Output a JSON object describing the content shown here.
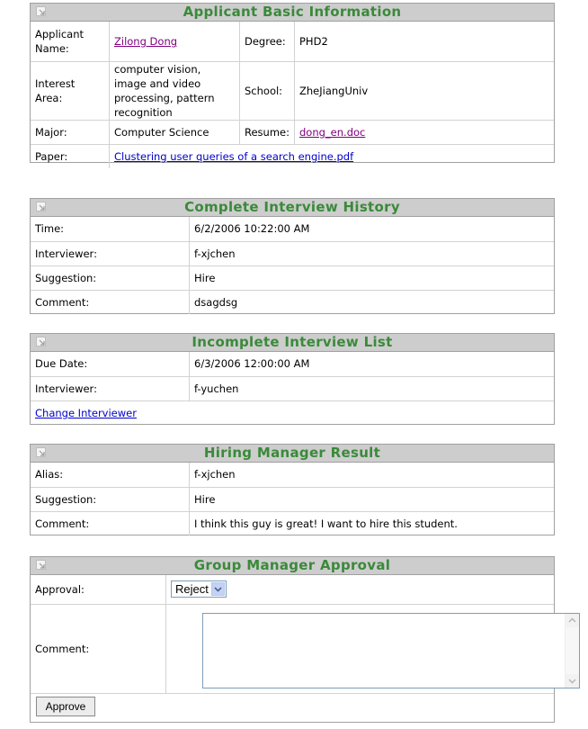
{
  "basic_info": {
    "title": "Applicant Basic Information",
    "applicant_name_label": "Applicant Name:",
    "applicant_name": "Zilong Dong",
    "degree_label": "Degree:",
    "degree": "PHD2",
    "interest_label": "Interest Area:",
    "interest": "computer vision, image and video processing, pattern recognition",
    "school_label": "School:",
    "school": "ZheJiangUniv",
    "major_label": "Major:",
    "major": "Computer Science",
    "resume_label": "Resume:",
    "resume": "dong_en.doc",
    "paper_label": "Paper:",
    "paper": "Clustering user queries of a search engine.pdf"
  },
  "complete_history": {
    "title": "Complete Interview History",
    "time_label": "Time:",
    "time": "6/2/2006 10:22:00 AM",
    "interviewer_label": "Interviewer:",
    "interviewer": "f-xjchen",
    "suggestion_label": "Suggestion:",
    "suggestion": "Hire",
    "comment_label": "Comment:",
    "comment": "dsagdsg"
  },
  "incomplete_list": {
    "title": "Incomplete Interview List",
    "due_date_label": "Due Date:",
    "due_date": "6/3/2006 12:00:00 AM",
    "interviewer_label": "Interviewer:",
    "interviewer": "f-yuchen",
    "change_link": "Change Interviewer"
  },
  "hiring_manager": {
    "title": "Hiring Manager Result",
    "alias_label": "Alias:",
    "alias": "f-xjchen",
    "suggestion_label": "Suggestion:",
    "suggestion": "Hire",
    "comment_label": "Comment:",
    "comment": "I think this guy is great! I want to hire this student."
  },
  "group_manager": {
    "title": "Group Manager Approval",
    "approval_label": "Approval:",
    "approval_value": "Reject",
    "comment_label": "Comment:",
    "comment_value": "",
    "approve_button": "Approve"
  },
  "colors": {
    "title_green": "#3a8a3a",
    "header_gray": "#cdcdcd",
    "link_blue": "#0000cc",
    "link_visited": "#800080"
  },
  "icons": {
    "panel_corner": "collapse-corner-icon",
    "select_arrow": "chevron-down-icon",
    "scroll_up": "scroll-up-arrow-icon",
    "scroll_down": "scroll-down-arrow-icon"
  }
}
